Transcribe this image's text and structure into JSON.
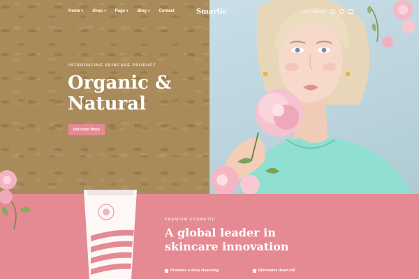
{
  "nav": {
    "items": [
      {
        "label": "Home",
        "caret": "▾"
      },
      {
        "label": "Shop",
        "caret": "▾"
      },
      {
        "label": "Page",
        "caret": "▾"
      },
      {
        "label": "Blog",
        "caret": "▾"
      },
      {
        "label": "Contact",
        "caret": ""
      }
    ]
  },
  "logo": {
    "text": "Smartic",
    "mark": "°"
  },
  "utility": {
    "login": "Login / Register"
  },
  "hero": {
    "eyebrow": "INTRODUCING SKINCARE PRODUCT",
    "title_line1": "Organic &",
    "title_line2": "Natural",
    "button_label": "Discover More"
  },
  "promo": {
    "eyebrow": "PREMIUM COSMETIC",
    "title_line1": "A global leader in",
    "title_line2": "skincare innovation",
    "features": [
      "Provides a deep cleansing",
      "Eliminates dead cell"
    ]
  },
  "colors": {
    "accent_pink": "#e58a93",
    "hero_brown": "#a98a5a",
    "sky": "#bcd4dd",
    "top_color": "#8fe0d0"
  },
  "icons": [
    "search-icon",
    "heart-icon",
    "cart-icon",
    "caret-down-icon",
    "check-icon"
  ]
}
